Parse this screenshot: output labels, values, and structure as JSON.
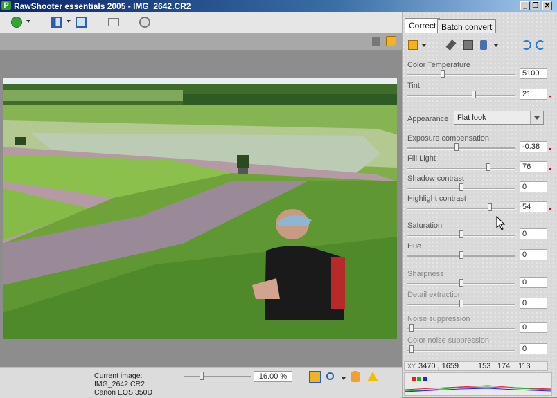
{
  "window": {
    "title": "RawShooter essentials 2005 - IMG_2642.CR2",
    "app_icon_letter": "P",
    "minimize": "_",
    "restore": "❐",
    "close": "✕"
  },
  "tabs": [
    {
      "label": "Correct",
      "active": true
    },
    {
      "label": "Batch convert",
      "active": false
    }
  ],
  "controls": [
    {
      "id": "color-temperature",
      "label": "Color Temperature",
      "value": "5100",
      "level": 0.32,
      "dim": false,
      "marker": false
    },
    {
      "id": "tint",
      "label": "Tint",
      "value": "21",
      "level": 0.62,
      "dim": false,
      "marker": true
    },
    {
      "id": "exposure-compensation",
      "label": "Exposure compensation",
      "value": "-0.38",
      "level": 0.45,
      "dim": false,
      "marker": true
    },
    {
      "id": "fill-light",
      "label": "Fill Light",
      "value": "76",
      "level": 0.76,
      "dim": false,
      "marker": true
    },
    {
      "id": "shadow-contrast",
      "label": "Shadow contrast",
      "value": "0",
      "level": 0.5,
      "dim": false,
      "marker": false
    },
    {
      "id": "highlight-contrast",
      "label": "Highlight contrast",
      "value": "54",
      "level": 0.77,
      "dim": false,
      "marker": true
    },
    {
      "id": "saturation",
      "label": "Saturation",
      "value": "0",
      "level": 0.5,
      "dim": false,
      "marker": false
    },
    {
      "id": "hue",
      "label": "Hue",
      "value": "0",
      "level": 0.5,
      "dim": false,
      "marker": false
    },
    {
      "id": "sharpness",
      "label": "Sharpness",
      "value": "0",
      "level": 0.5,
      "dim": true,
      "marker": false
    },
    {
      "id": "detail-extraction",
      "label": "Detail extraction",
      "value": "0",
      "level": 0.5,
      "dim": true,
      "marker": false
    },
    {
      "id": "noise-suppression",
      "label": "Noise suppression",
      "value": "0",
      "level": 0.02,
      "dim": true,
      "marker": false
    },
    {
      "id": "color-noise-suppression",
      "label": "Color noise suppression",
      "value": "0",
      "level": 0.02,
      "dim": true,
      "marker": false
    }
  ],
  "appearance": {
    "label": "Appearance",
    "value": "Flat look"
  },
  "readout": {
    "xy_label": "XY",
    "xy": "3470 , 1659",
    "r": "153",
    "g": "174",
    "b": "113"
  },
  "status": {
    "current_image_label": "Current image:",
    "filename": "IMG_2642.CR2",
    "camera": "Canon EOS 350D",
    "zoom": "16.00 %",
    "zoom_level": 0.28
  },
  "colors": {
    "accent": "#0a246a",
    "marker": "#cc0000",
    "panel_bg": "#d9d9d9"
  }
}
